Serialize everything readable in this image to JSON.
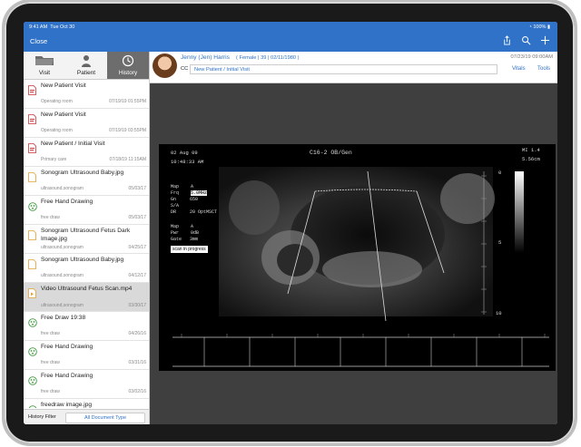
{
  "status": {
    "time": "9:41 AM",
    "date": "Tue Oct 30",
    "battery": "100%"
  },
  "nav": {
    "close": "Close"
  },
  "tabs": [
    {
      "label": "Visit"
    },
    {
      "label": "Patient"
    },
    {
      "label": "History"
    }
  ],
  "history": [
    {
      "title": "New Patient Visit",
      "sub": "Operating room",
      "date": "07/19/19 01:55PM",
      "icon": "pdf-icon"
    },
    {
      "title": "New Patient Visit",
      "sub": "Operating room",
      "date": "07/19/19 03:55PM",
      "icon": "pdf-icon"
    },
    {
      "title": "New Patient / Initial Visit",
      "sub": "Primary care",
      "date": "07/18/19 11:15AM",
      "icon": "pdf-icon"
    },
    {
      "title": "Sonogram Ultrasound Baby.jpg",
      "sub": "ultrasound,sonogram",
      "date": "05/03/17",
      "icon": "image-file-icon"
    },
    {
      "title": "Free Hand Drawing",
      "sub": "free draw",
      "date": "05/03/17",
      "icon": "drawing-icon"
    },
    {
      "title": "Sonogram Ultrasound Fetus Dark Image.jpg",
      "sub": "ultrasound,sonogram",
      "date": "04/25/17",
      "icon": "image-file-icon"
    },
    {
      "title": "Sonogram Ultrasound Baby.jpg",
      "sub": "ultrasound,sonogram",
      "date": "04/12/17",
      "icon": "image-file-icon"
    },
    {
      "title": "Video Ultrasound Fetus Scan.mp4",
      "sub": "ultrasound,sonogram",
      "date": "03/30/17",
      "icon": "video-file-icon"
    },
    {
      "title": "Free Draw 19:38",
      "sub": "free draw",
      "date": "04/26/16",
      "icon": "drawing-icon"
    },
    {
      "title": "Free Hand Drawing",
      "sub": "free draw",
      "date": "03/31/16",
      "icon": "drawing-icon"
    },
    {
      "title": "Free Hand Drawing",
      "sub": "free draw",
      "date": "03/02/16",
      "icon": "drawing-icon"
    },
    {
      "title": "freedraw image.jpg",
      "sub": "image,free draw embed",
      "date": "12/11/14",
      "icon": "drawing-icon"
    }
  ],
  "filter": {
    "label": "History Filter",
    "value": "All Document Type"
  },
  "patient": {
    "name": "Jenny (Jen) Harris",
    "demo": "( Female | 39 | 02/11/1980 )",
    "visit_date": "07/23/19 09:00AM",
    "cc_label": "CC",
    "cc_value": "New Patient / Initial Visit",
    "vitals": "Vitals",
    "tools": "Tools"
  },
  "ultrasound": {
    "date": "02 Aug 09",
    "time": "10:48:33 AM",
    "probe": "C16-2 OB/Gen",
    "mi": "MI 1.4",
    "depth": "5.56cm",
    "params": [
      "Map",
      "Frq",
      "Gn",
      "S/A",
      "DR"
    ],
    "param_vals": [
      "A",
      "5.0MHz",
      "650",
      "",
      "20 OptMSCT"
    ],
    "params2": [
      "Map",
      "Pwr",
      "Gate"
    ],
    "param2_vals": [
      "A",
      "0dB",
      "3mm"
    ],
    "status": "scan in progress",
    "scale": [
      "0",
      "5",
      "10"
    ]
  }
}
